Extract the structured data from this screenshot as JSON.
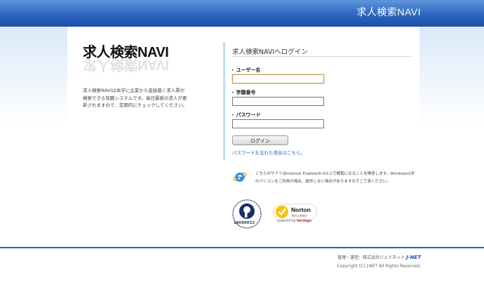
{
  "header": {
    "title": "求人検索NAVI"
  },
  "brand": {
    "logo_text": "求人検索NAVI",
    "description": "求人検索NAVIは本学に企業から直接届く求人票が検索できる就職システムです。毎日最新の求人が更新されますので、定期的にチェックしてください。"
  },
  "login": {
    "title": "求人検索NAVIへログイン",
    "username_label": "ユーザー名",
    "username_value": "",
    "student_id_label": "学籍番号",
    "student_id_value": "",
    "password_label": "パスワード",
    "password_value": "",
    "login_button": "ログイン",
    "forgot_link": "パスワードを忘れた場合はこちら。"
  },
  "notice": {
    "text": "こちらのサイトはInternet Explorer6.0以上で閲覧になることを推奨します。Windows以外のパソコンをご利用の場合、動作しない場合がありますのでご了承ください。"
  },
  "badges": {
    "privacy_number": "19000032",
    "norton_label": "Norton",
    "norton_secured": "SECURED",
    "norton_by_prefix": "powered by ",
    "norton_by_brand": "VeriSign"
  },
  "footer": {
    "admin_text": "管理・運営：株式会社ジェイネット",
    "admin_brand": "J-NET",
    "copyright": "Copyright (C) J-NET All Rights Reserved."
  },
  "colors": {
    "primary": "#2a63bd",
    "accent_line": "#b8dcf6",
    "link": "#2a63bd"
  }
}
